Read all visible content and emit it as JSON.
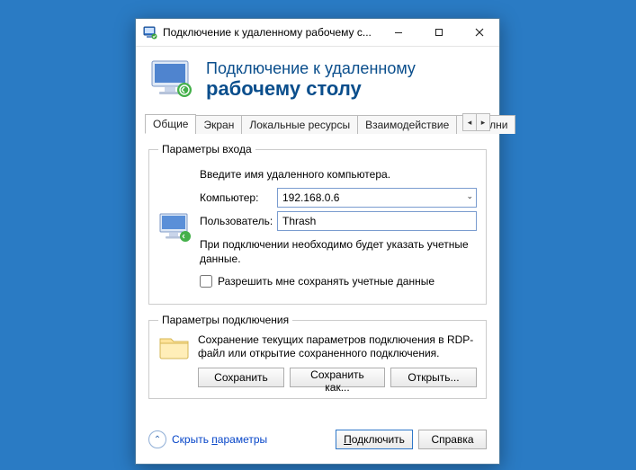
{
  "window": {
    "title": "Подключение к удаленному рабочему с..."
  },
  "banner": {
    "line1": "Подключение к удаленному",
    "line2": "рабочему столу"
  },
  "tabs": {
    "items": [
      "Общие",
      "Экран",
      "Локальные ресурсы",
      "Взаимодействие",
      "Дополни"
    ],
    "selected_index": 0
  },
  "login_group": {
    "legend": "Параметры входа",
    "intro": "Введите имя удаленного компьютера.",
    "computer_label": "Компьютер:",
    "computer_value": "192.168.0.6",
    "user_label": "Пользователь:",
    "user_value": "Thrash",
    "note": "При подключении необходимо будет указать учетные данные.",
    "checkbox_label": "Разрешить мне сохранять учетные данные"
  },
  "conn_group": {
    "legend": "Параметры подключения",
    "text": "Сохранение текущих параметров подключения в RDP-файл или открытие сохраненного подключения.",
    "save_label": "Сохранить",
    "save_as_label": "Сохранить как...",
    "open_label": "Открыть..."
  },
  "footer": {
    "hide_params_prefix": "Скрыть ",
    "hide_params_underlined": "п",
    "hide_params_suffix": "араметры",
    "connect_underlined": "П",
    "connect_suffix": "одключить",
    "help_label": "Справка"
  },
  "icons": {
    "app": "rdp-icon",
    "minimize": "minimize-icon",
    "maximize": "maximize-icon",
    "close": "close-icon",
    "dropdown": "chevron-down-icon",
    "tab_left": "chevron-left-icon",
    "tab_right": "chevron-right-icon",
    "collapse": "chevron-up-circle-icon",
    "monitor": "monitor-icon",
    "folder": "folder-icon"
  }
}
